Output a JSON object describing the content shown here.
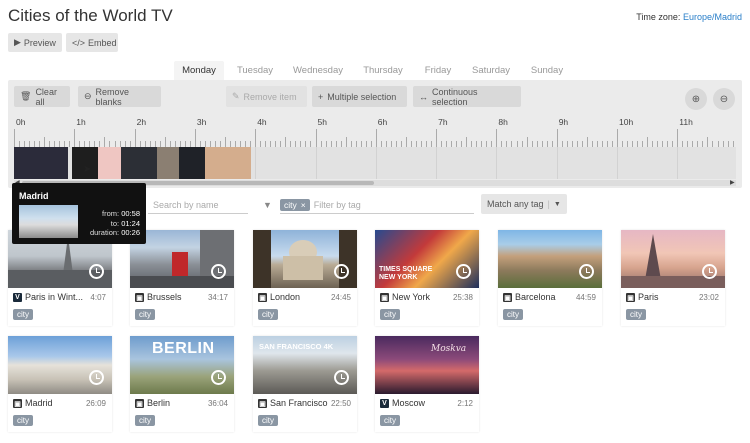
{
  "app": {
    "title": "Cities of the World TV",
    "timezone_label": "Time zone:",
    "timezone_value": "Europe/Madrid",
    "preview_label": "Preview",
    "embed_label": "Embed"
  },
  "days": [
    {
      "label": "Monday",
      "active": true
    },
    {
      "label": "Tuesday",
      "active": false
    },
    {
      "label": "Wednesday",
      "active": false
    },
    {
      "label": "Thursday",
      "active": false
    },
    {
      "label": "Friday",
      "active": false
    },
    {
      "label": "Saturday",
      "active": false
    },
    {
      "label": "Sunday",
      "active": false
    }
  ],
  "toolbar": {
    "clear_all": "Clear all",
    "remove_blanks": "Remove blanks",
    "remove_item": "Remove item",
    "multiple_selection": "Multiple selection",
    "continuous_selection": "Continuous selection"
  },
  "timeline": {
    "hours": [
      "0h",
      "1h",
      "2h",
      "3h",
      "4h",
      "5h",
      "6h",
      "7h",
      "8h",
      "9h",
      "10h",
      "11h"
    ],
    "blocks": [
      {
        "start_min": 0,
        "end_min": 54,
        "color": "#2b2b3a"
      },
      {
        "start_min": 58,
        "end_min": 84,
        "color": "#1e1e1e"
      },
      {
        "start_min": 84,
        "end_min": 106,
        "color": "#efc6c2"
      },
      {
        "start_min": 106,
        "end_min": 142,
        "color": "#2c2f36"
      },
      {
        "start_min": 142,
        "end_min": 164,
        "color": "#8b7f72"
      },
      {
        "start_min": 164,
        "end_min": 190,
        "color": "#1f2228"
      },
      {
        "start_min": 190,
        "end_min": 236,
        "color": "#d4ad8d"
      }
    ]
  },
  "tooltip": {
    "title": "Madrid",
    "from_label": "from:",
    "from_value": "00:58",
    "to_label": "to:",
    "to_value": "01:24",
    "duration_label": "duration:",
    "duration_value": "00:26"
  },
  "filters": {
    "search_placeholder": "Search by name",
    "tag_chip": "city",
    "tag_remove": "×",
    "tag_placeholder": "Filter by tag",
    "match_label": "Match any tag"
  },
  "videos": [
    {
      "name": "Paris in Wint...",
      "duration": "4:07",
      "source": "vimeo",
      "tag": "city"
    },
    {
      "name": "Brussels",
      "duration": "34:17",
      "source": "youtube",
      "tag": "city"
    },
    {
      "name": "London",
      "duration": "24:45",
      "source": "youtube",
      "tag": "city"
    },
    {
      "name": "New York",
      "duration": "25:38",
      "source": "youtube",
      "tag": "city"
    },
    {
      "name": "Barcelona",
      "duration": "44:59",
      "source": "youtube",
      "tag": "city"
    },
    {
      "name": "Paris",
      "duration": "23:02",
      "source": "youtube",
      "tag": "city"
    },
    {
      "name": "Madrid",
      "duration": "26:09",
      "source": "youtube",
      "tag": "city"
    },
    {
      "name": "Berlin",
      "duration": "36:04",
      "source": "youtube",
      "tag": "city"
    },
    {
      "name": "San Francisco",
      "duration": "22:50",
      "source": "youtube",
      "tag": "city"
    },
    {
      "name": "Moscow",
      "duration": "2:12",
      "source": "vimeo",
      "tag": "city"
    }
  ],
  "thumb_text": {
    "new_york": "TIMES SQUARE NEW YORK",
    "berlin": "BERLIN",
    "san_francisco": "SAN FRANCISCO 4K",
    "moscow": "Moskva"
  },
  "colors": {
    "accent_link": "#2a7fc9",
    "tag_bg": "#8a96a3"
  }
}
